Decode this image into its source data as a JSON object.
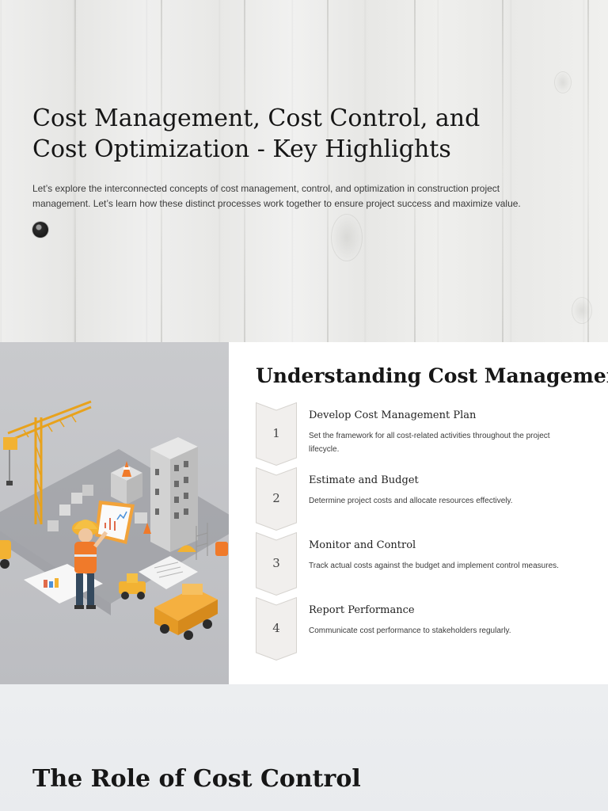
{
  "hero": {
    "title": "Cost Management, Cost Control, and Cost Optimization - Key Highlights",
    "description": "Let’s explore the interconnected concepts of cost management, control, and optimization in construction project management. Let’s learn how these distinct processes work together to ensure project success and maximize value."
  },
  "cost_management": {
    "title": "Understanding Cost Management",
    "steps": [
      {
        "number": "1",
        "title": "Develop Cost Management Plan",
        "description": "Set the framework for all cost-related activities throughout the project lifecycle."
      },
      {
        "number": "2",
        "title": "Estimate and Budget",
        "description": "Determine project costs and allocate resources effectively."
      },
      {
        "number": "3",
        "title": "Monitor and Control",
        "description": "Track actual costs against the budget and implement control measures."
      },
      {
        "number": "4",
        "title": "Report Performance",
        "description": "Communicate cost performance to stakeholders regularly."
      }
    ]
  },
  "cost_control": {
    "title": "The Role of Cost Control"
  },
  "colors": {
    "chevron_fill": "#f1efed",
    "chevron_stroke": "#d6d3cf",
    "accent_yellow": "#f2b233",
    "safety_orange": "#f07a2a"
  }
}
